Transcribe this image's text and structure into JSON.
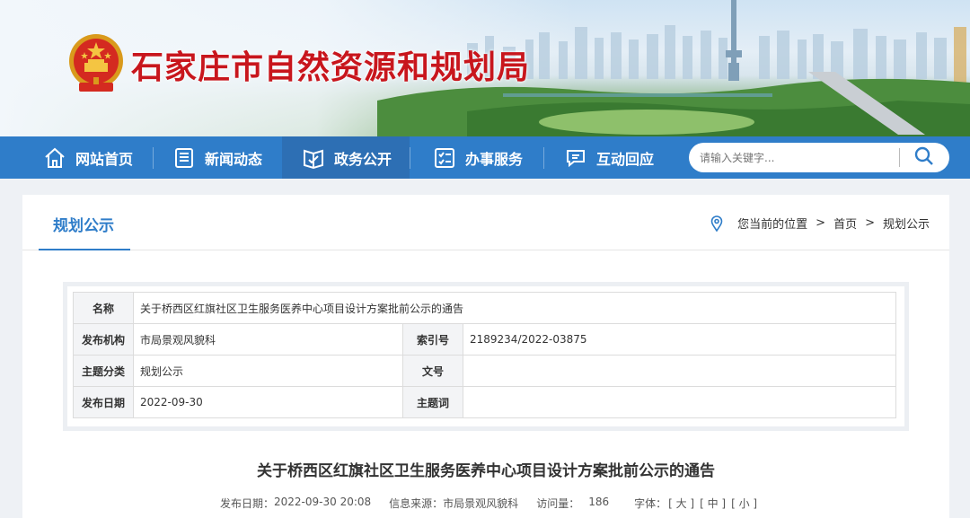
{
  "header": {
    "site_title": "石家庄市自然资源和规划局",
    "emblem": "national-emblem"
  },
  "nav": {
    "items": [
      {
        "label": "网站首页",
        "icon": "home-icon"
      },
      {
        "label": "新闻动态",
        "icon": "newspaper-icon"
      },
      {
        "label": "政务公开",
        "icon": "open-book-icon"
      },
      {
        "label": "办事服务",
        "icon": "checklist-icon"
      },
      {
        "label": "互动回应",
        "icon": "chat-icon"
      }
    ],
    "search_placeholder": "请输入关键字...",
    "accent": "#2f7dc9"
  },
  "section": {
    "title": "规划公示",
    "breadcrumb": {
      "prefix": "您当前的位置",
      "items": [
        "首页",
        "规划公示"
      ],
      "separator": ">"
    }
  },
  "info_table": {
    "name_label": "名称",
    "name_value": "关于桥西区红旗社区卫生服务医养中心项目设计方案批前公示的通告",
    "publisher_label": "发布机构",
    "publisher_value": "市局景观风貌科",
    "index_label": "索引号",
    "index_value": "2189234/2022-03875",
    "topic_label": "主题分类",
    "topic_value": "规划公示",
    "docno_label": "文号",
    "docno_value": "",
    "date_label": "发布日期",
    "date_value": "2022-09-30",
    "keyword_label": "主题词",
    "keyword_value": ""
  },
  "article": {
    "title": "关于桥西区红旗社区卫生服务医养中心项目设计方案批前公示的通告",
    "publish_label": "发布日期：",
    "publish_value": "2022-09-30 20:08",
    "source_label": "信息来源：",
    "source_value": "市局景观风貌科",
    "views_label": "访问量：",
    "views_value": "186",
    "font_label": "字体：",
    "font_large": "[ 大 ]",
    "font_medium": "[ 中 ]",
    "font_small": "[ 小 ]"
  }
}
